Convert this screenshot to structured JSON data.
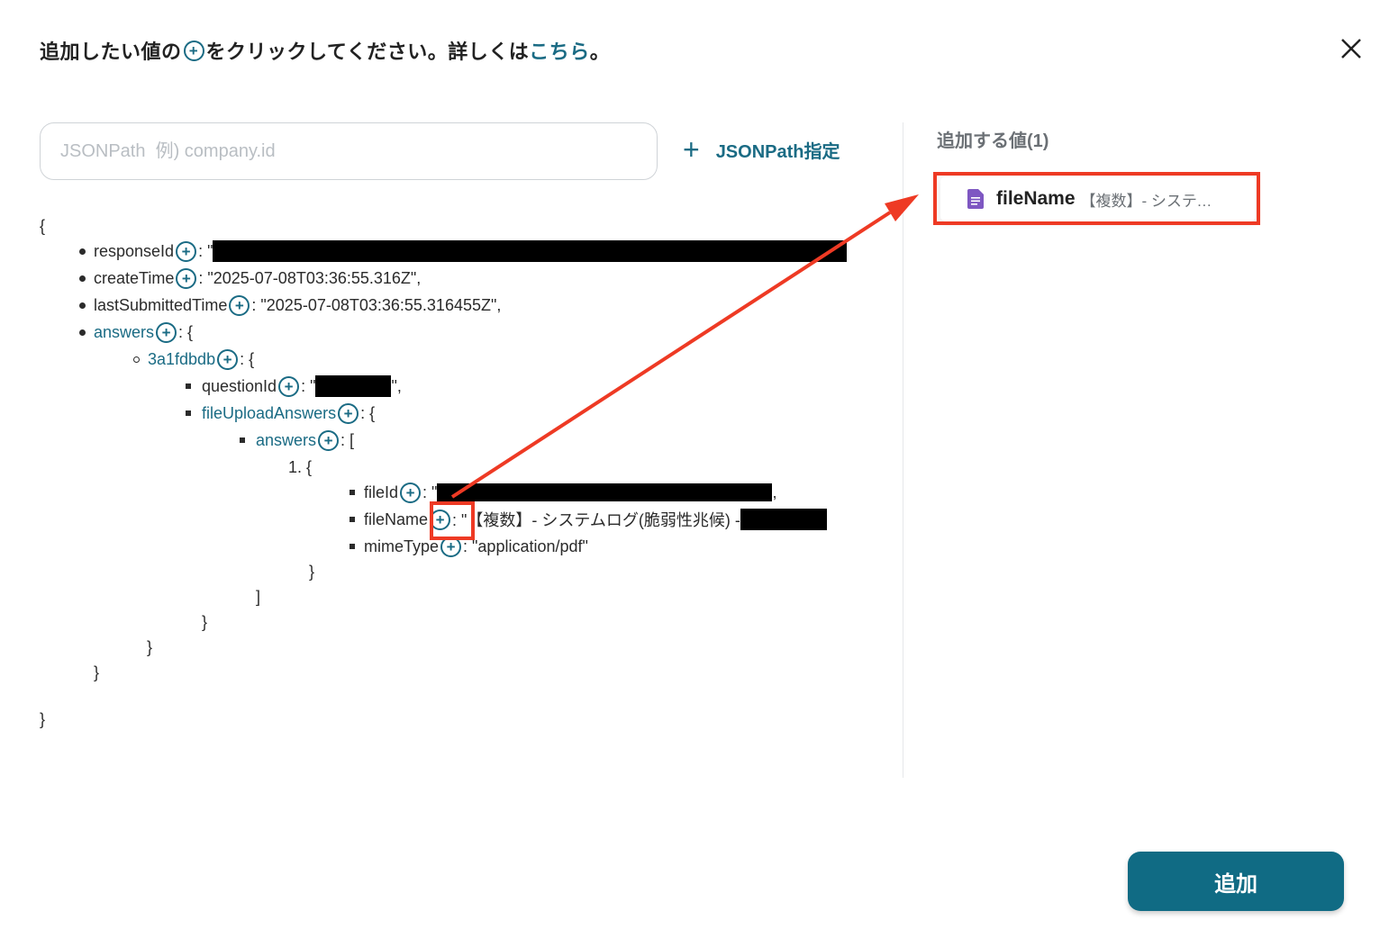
{
  "header": {
    "before_plus": "追加したい値の",
    "after_plus": "をクリックしてください。詳しくは",
    "link": "こちら",
    "end": "。"
  },
  "icons": {
    "close": "close-icon",
    "add": "plus-circle-icon",
    "doc": "document-icon"
  },
  "search": {
    "placeholder": "JSONPath  例) company.id",
    "value": ""
  },
  "jsonpath_button": {
    "icon": "+",
    "label": "JSONPath指定"
  },
  "tree": {
    "open": "{",
    "close_root": "}",
    "responseId_key": "responseId",
    "responseId_prefix": ": \"",
    "createTime_key": "createTime",
    "createTime_val": ": \"2025-07-08T03:36:55.316Z\",",
    "lastSubmittedTime_key": "lastSubmittedTime",
    "lastSubmittedTime_val": ": \"2025-07-08T03:36:55.316455Z\",",
    "answers_key": "answers",
    "obj_open": ": {",
    "item_key": "3a1fdbdb",
    "questionId_key": "questionId",
    "questionId_prefix": ": \"",
    "questionId_suffix": "\",",
    "fileUploadAnswers_key": "fileUploadAnswers",
    "inner_answers_key": "answers",
    "arr_open": ": [",
    "list_num": "1. {",
    "fileId_key": "fileId",
    "fileId_prefix": ": \"",
    "fileId_suffix": ",",
    "fileName_key": "fileName",
    "fileName_val": ": \"【複数】- システムログ(脆弱性兆候) -",
    "mimeType_key": "mimeType",
    "mimeType_val": ": \"application/pdf\"",
    "close_brace": "}",
    "close_bracket": "]"
  },
  "right": {
    "title": "追加する値(1)",
    "value_name": "fileName",
    "value_sub": "【複数】- システムログ(脆弱性兆候) -"
  },
  "add_button": {
    "label": "追加"
  },
  "colors": {
    "accent": "#106b84",
    "highlight": "#ee3a24",
    "icon_purple": "#7e57c2"
  }
}
